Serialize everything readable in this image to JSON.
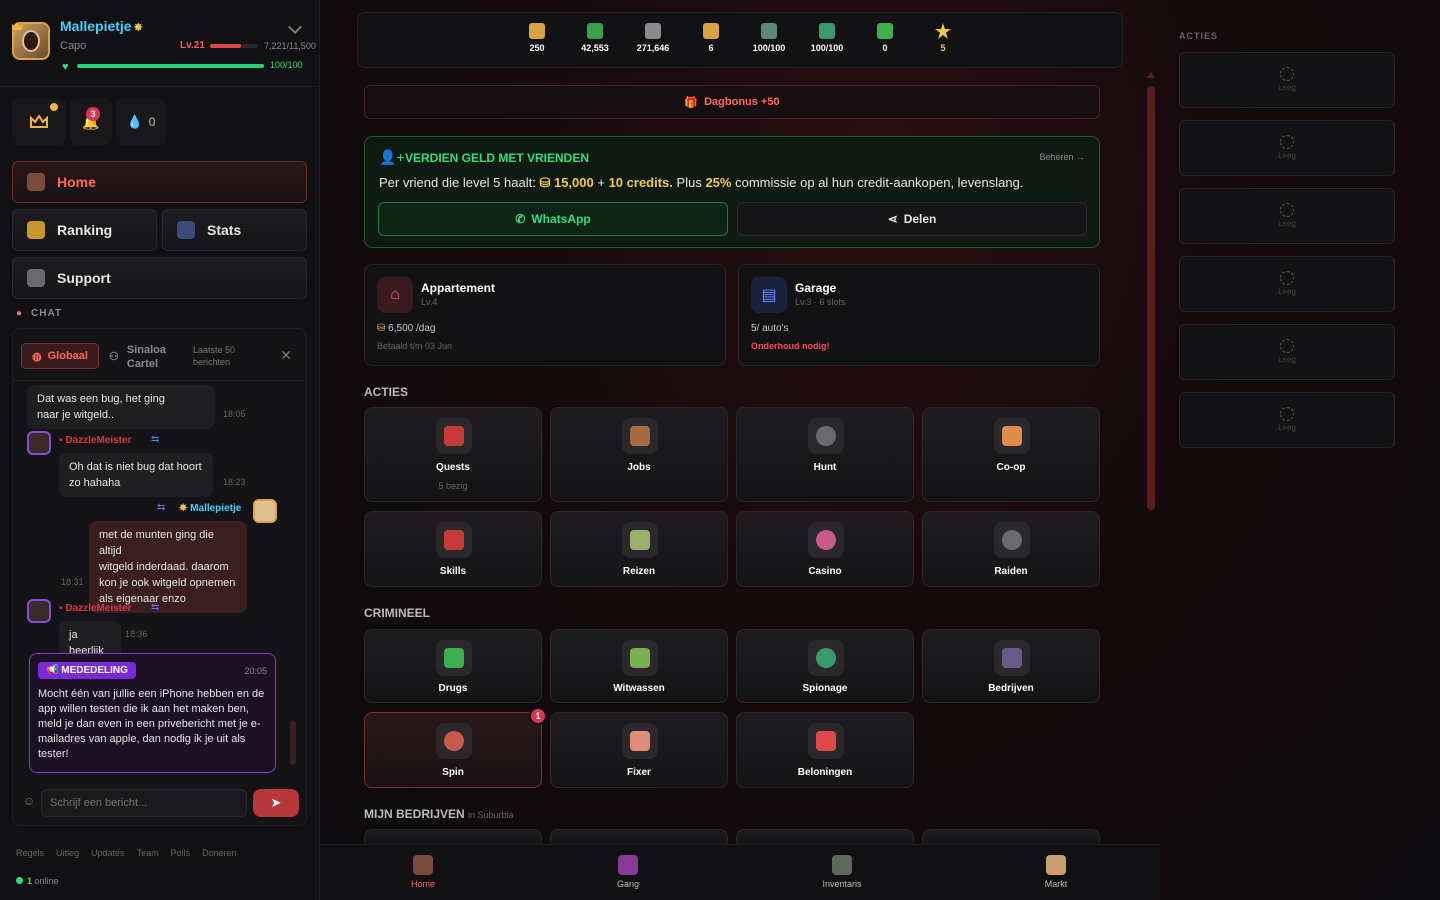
{
  "profile": {
    "username": "Mallepietje",
    "rank": "Capo",
    "level": "Lv.21",
    "level_progress": 0.64,
    "xp": "7,221/11,500",
    "hp": "100/100",
    "hp_progress": 1.0
  },
  "quick": {
    "fire_count": "0",
    "bell_badge": "3"
  },
  "nav": {
    "home": "Home",
    "ranking": "Ranking",
    "stats": "Stats",
    "support": "Support"
  },
  "chat": {
    "label": "CHAT",
    "tab_global": "Globaal",
    "tab_cartel_1": "Sinaloa",
    "tab_cartel_2": "Cartel",
    "last_1": "Laatste 50",
    "last_2": "berichten",
    "messages": [
      {
        "text_1": "Dat was een bug, het ging",
        "text_2": "naar je witgeld..",
        "time": "18:05"
      },
      {
        "sender": "DazzleMeister",
        "text_1": "Oh dat is niet bug dat hoort",
        "text_2": "zo hahaha",
        "time": "18:23"
      },
      {
        "sender": "Mallepietje",
        "text_1": "met de munten ging die altijd",
        "text_2": "witgeld inderdaad. daarom",
        "text_3": "kon je ook witgeld opnemen",
        "text_4": "als eigenaar enzo",
        "time": "18:31"
      },
      {
        "sender": "DazzleMeister",
        "text_1": "ja heerlijk",
        "time": "18:36"
      }
    ],
    "notice": {
      "tag": "MEDEDELING",
      "time": "20:05",
      "text": "Mocht één van jullie een iPhone hebben en de app willen testen die ik aan het maken ben, meld je dan even in een privebericht met je e-mailadres van apple, dan nodig ik je uit als tester!"
    },
    "input_placeholder": "Schrijf een bericht..."
  },
  "footer": {
    "links": [
      "Regels",
      "Uitleg",
      "Updates",
      "Team",
      "Polls",
      "Doneren"
    ],
    "online_count": "1",
    "online_label": "online"
  },
  "resources": [
    "250",
    "42,553",
    "271,646",
    "6",
    "100/100",
    "100/100",
    "0",
    "5"
  ],
  "dagbonus": "Dagbonus +50",
  "referral": {
    "title": "VERDIEN GELD MET VRIENDEN",
    "manage": "Beheren",
    "text_pre": "Per vriend die level 5 haalt:",
    "amount": "15,000",
    "plus": "+",
    "credits": "10 credits.",
    "plus_text": "Plus",
    "percent": "25%",
    "text_post": "commissie op al hun credit-aankopen, levenslang.",
    "whatsapp": "WhatsApp",
    "share": "Delen"
  },
  "properties": [
    {
      "title": "Appartement",
      "sub": "Lv.4",
      "line1": "6,500 /dag",
      "line2": "Betaald t/m 03 Jun"
    },
    {
      "title": "Garage",
      "sub": "Lv.3 · 6 slots",
      "line1": "5/ auto's",
      "line2": "Onderhoud nodig!"
    }
  ],
  "sections": {
    "acties": "ACTIES",
    "crimineel": "CRIMINEEL",
    "bedrijven": "MIJN BEDRIJVEN",
    "bedrijven_loc": "in Suburbia"
  },
  "acties": [
    {
      "label": "Quests",
      "sub": "5 bezig"
    },
    {
      "label": "Jobs"
    },
    {
      "label": "Hunt"
    },
    {
      "label": "Co-op"
    },
    {
      "label": "Skills"
    },
    {
      "label": "Reizen"
    },
    {
      "label": "Casino"
    },
    {
      "label": "Raiden"
    }
  ],
  "crimineel": [
    {
      "label": "Drugs"
    },
    {
      "label": "Witwassen"
    },
    {
      "label": "Spionage"
    },
    {
      "label": "Bedrijven"
    },
    {
      "label": "Spin",
      "badge": "1"
    },
    {
      "label": "Fixer"
    },
    {
      "label": "Beloningen"
    }
  ],
  "bottom_nav": [
    "Home",
    "Gang",
    "Inventaris",
    "Markt"
  ],
  "right": {
    "title": "ACTIES",
    "slots": [
      "Leeg",
      "Leeg",
      "Leeg",
      "Leeg",
      "Leeg",
      "Leeg"
    ]
  }
}
